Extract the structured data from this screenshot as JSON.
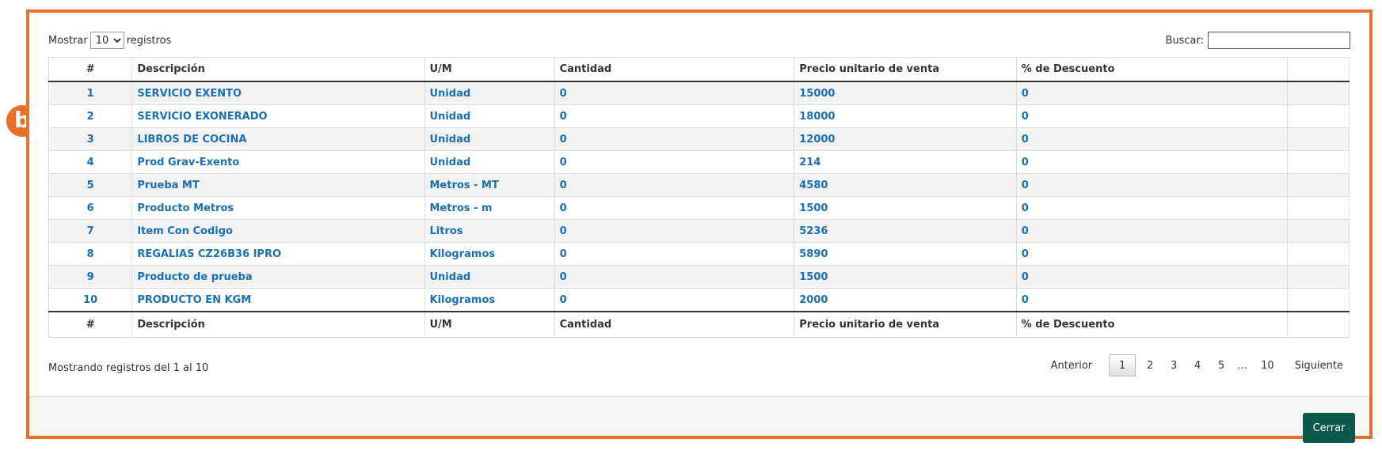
{
  "badge": {
    "label": "b"
  },
  "length_control": {
    "prefix": "Mostrar",
    "selected": "10",
    "suffix": "registros"
  },
  "search": {
    "label": "Buscar:",
    "value": ""
  },
  "table": {
    "columns": [
      "#",
      "Descripción",
      "U/M",
      "Cantidad",
      "Precio unitario de venta",
      "% de Descuento",
      ""
    ],
    "rows": [
      [
        "1",
        "SERVICIO EXENTO",
        "Unidad",
        "0",
        "15000",
        "0",
        ""
      ],
      [
        "2",
        "SERVICIO EXONERADO",
        "Unidad",
        "0",
        "18000",
        "0",
        ""
      ],
      [
        "3",
        "LIBROS DE COCINA",
        "Unidad",
        "0",
        "12000",
        "0",
        ""
      ],
      [
        "4",
        "Prod Grav-Exento",
        "Unidad",
        "0",
        "214",
        "0",
        ""
      ],
      [
        "5",
        "Prueba MT",
        "Metros - MT",
        "0",
        "4580",
        "0",
        ""
      ],
      [
        "6",
        "Producto Metros",
        "Metros - m",
        "0",
        "1500",
        "0",
        ""
      ],
      [
        "7",
        "Item Con Codigo",
        "Litros",
        "0",
        "5236",
        "0",
        ""
      ],
      [
        "8",
        "REGALIAS CZ26B36 IPRO",
        "Kilogramos",
        "0",
        "5890",
        "0",
        ""
      ],
      [
        "9",
        "Producto de prueba",
        "Unidad",
        "0",
        "1500",
        "0",
        ""
      ],
      [
        "10",
        "PRODUCTO EN KGM",
        "Kilogramos",
        "0",
        "2000",
        "0",
        ""
      ]
    ]
  },
  "info": "Mostrando registros del 1 al 10",
  "pagination": {
    "previous": "Anterior",
    "pages": [
      "1",
      "2",
      "3",
      "4",
      "5"
    ],
    "ellipsis": "…",
    "last": "10",
    "next": "Siguiente",
    "current": "1"
  },
  "footer": {
    "close_label": "Cerrar"
  },
  "colors": {
    "frame_border": "#e8702a",
    "link_text": "#1a6fb5",
    "close_button": "#0c5a4c"
  }
}
